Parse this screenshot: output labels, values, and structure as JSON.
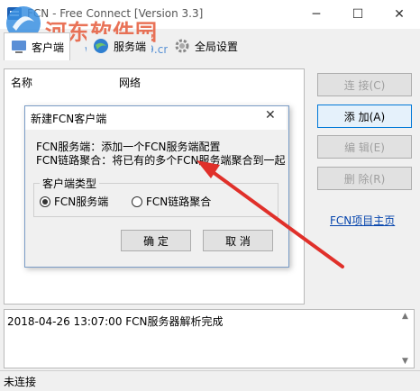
{
  "window": {
    "title": "FCN - Free Connect [Version 3.3]",
    "minimize": "─",
    "maximize": "☐",
    "close": "✕"
  },
  "watermark": {
    "text": "河东软件园",
    "url": "www.pc0359.cn"
  },
  "tabs": [
    {
      "label": "客户端",
      "active": true
    },
    {
      "label": "服务端",
      "active": false
    },
    {
      "label": "全局设置",
      "active": false
    }
  ],
  "list": {
    "columns": [
      "名称",
      "网络"
    ]
  },
  "side_buttons": {
    "connect": "连 接(C)",
    "add": "添 加(A)",
    "edit": "编 辑(E)",
    "delete": "删 除(R)"
  },
  "home_link": "FCN项目主页",
  "log": {
    "lines": [
      "2018-04-26 13:07:00 FCN服务器解析完成"
    ]
  },
  "status": "未连接",
  "dialog": {
    "title": "新建FCN客户端",
    "close": "✕",
    "line1": "FCN服务端：添加一个FCN服务端配置",
    "line2": "FCN链路聚合：将已有的多个FCN服务端聚合到一起",
    "group_label": "客户端类型",
    "options": [
      {
        "label": "FCN服务端",
        "selected": true
      },
      {
        "label": "FCN链路聚合",
        "selected": false
      }
    ],
    "ok": "确 定",
    "cancel": "取 消"
  },
  "colors": {
    "arrow": "#e0302a",
    "link": "#0645ad",
    "accent": "#0078d7"
  }
}
